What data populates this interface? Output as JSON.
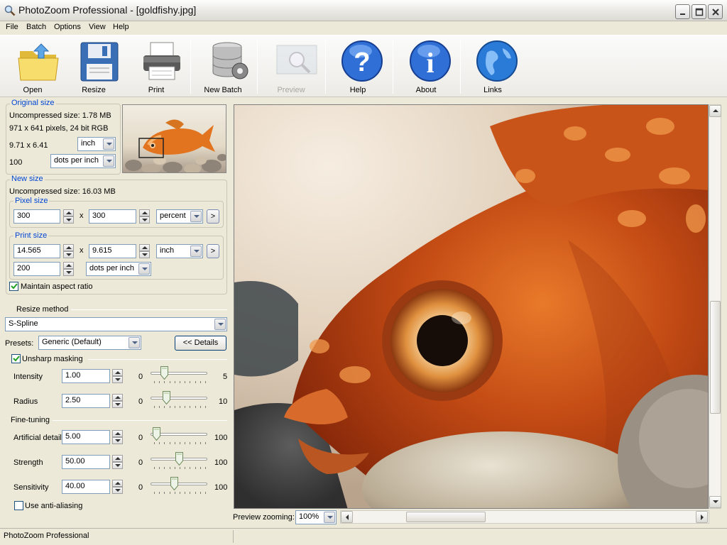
{
  "window": {
    "title": "PhotoZoom Professional - [goldfishy.jpg]"
  },
  "menu": [
    "File",
    "Batch",
    "Options",
    "View",
    "Help"
  ],
  "toolbar": {
    "open": "Open",
    "resize": "Resize",
    "print": "Print",
    "new_batch": "New Batch",
    "preview": "Preview",
    "help": "Help",
    "about": "About",
    "links": "Links"
  },
  "original": {
    "title": "Original size",
    "uncompressed": "Uncompressed size: 1.78 MB",
    "pixels": "971 x 641 pixels, 24 bit RGB",
    "dims": "9.71 x 6.41",
    "unit": "inch",
    "resolution": "100",
    "res_unit": "dots per inch"
  },
  "new_size": {
    "title": "New size",
    "uncompressed": "Uncompressed size: 16.03 MB",
    "pixel_title": "Pixel size",
    "pixel_w": "300",
    "x": "x",
    "pixel_h": "300",
    "pixel_unit": "percent",
    "go": ">",
    "print_title": "Print size",
    "print_w": "14.565",
    "print_h": "9.615",
    "print_unit": "inch",
    "print_res": "200",
    "print_res_unit": "dots per inch",
    "maintain": "Maintain aspect ratio"
  },
  "resize": {
    "method_title": "Resize method",
    "method": "S-Spline",
    "presets_label": "Presets:",
    "preset": "Generic (Default)",
    "details": "<< Details"
  },
  "unsharp": {
    "title": "Unsharp masking",
    "intensity_label": "Intensity",
    "intensity": "1.00",
    "intensity_min": "0",
    "intensity_max": "5",
    "intensity_level": 0.2,
    "radius_label": "Radius",
    "radius": "2.50",
    "radius_min": "0",
    "radius_max": "10",
    "radius_level": 0.25
  },
  "fine": {
    "title": "Fine-tuning",
    "detail_label": "Artificial detail",
    "detail": "5.00",
    "detail_min": "0",
    "detail_max": "100",
    "detail_level": 0.05,
    "strength_label": "Strength",
    "strength": "50.00",
    "strength_min": "0",
    "strength_max": "100",
    "strength_level": 0.5,
    "sensitivity_label": "Sensitivity",
    "sensitivity": "40.00",
    "sensitivity_min": "0",
    "sensitivity_max": "100",
    "sensitivity_level": 0.4,
    "antialias": "Use anti-aliasing"
  },
  "preview": {
    "zoom_label": "Preview zooming:",
    "zoom": "100%"
  },
  "status": {
    "text": "PhotoZoom Professional"
  }
}
